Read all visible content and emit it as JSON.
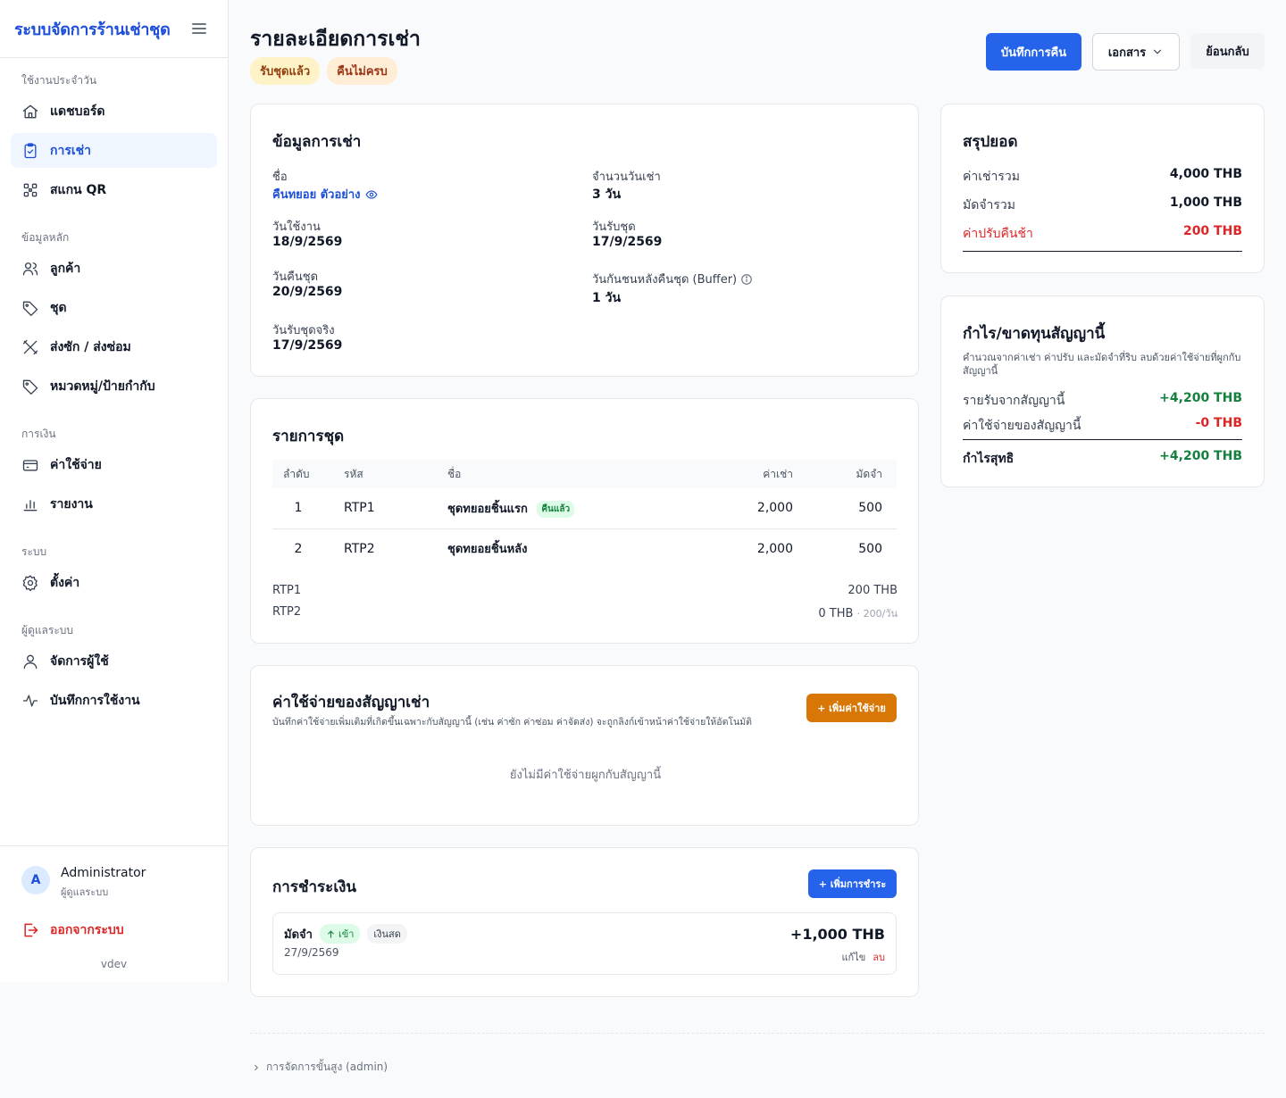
{
  "sidebar": {
    "title": "ระบบจัดการร้านเช่าชุด",
    "sections": {
      "daily": "ใช้งานประจำวัน",
      "master": "ข้อมูลหลัก",
      "finance": "การเงิน",
      "system": "ระบบ",
      "admin": "ผู้ดูแลระบบ"
    },
    "items": {
      "dashboard": "แดชบอร์ด",
      "rentals": "การเช่า",
      "scan_qr": "สแกน QR",
      "customers": "ลูกค้า",
      "outfits": "ชุด",
      "laundry": "ส่งซัก / ส่งซ่อม",
      "categories": "หมวดหมู่/ป้ายกำกับ",
      "expenses": "ค่าใช้จ่าย",
      "reports": "รายงาน",
      "settings": "ตั้งค่า",
      "users": "จัดการผู้ใช้",
      "activity_log": "บันทึกการใช้งาน"
    },
    "user": {
      "initial": "A",
      "name": "Administrator",
      "role": "ผู้ดูแลระบบ"
    },
    "logout": "ออกจากระบบ",
    "version": "vdev"
  },
  "header": {
    "title": "รายละเอียดการเช่า",
    "badges": [
      "รับชุดแล้ว",
      "คืนไม่ครบ"
    ],
    "actions": {
      "record_return": "บันทึกการคืน",
      "documents": "เอกสาร",
      "back": "ย้อนกลับ"
    }
  },
  "rental_info": {
    "title": "ข้อมูลการเช่า",
    "name_label": "ชื่อ",
    "name_value": "คืนทยอย ตัวอย่าง",
    "days_label": "จำนวนวันเช่า",
    "days_value": "3 วัน",
    "use_date_label": "วันใช้งาน",
    "use_date_value": "18/9/2569",
    "pickup_date_label": "วันรับชุด",
    "pickup_date_value": "17/9/2569",
    "return_date_label": "วันคืนชุด",
    "return_date_value": "20/9/2569",
    "buffer_label": "วันกันชนหลังคืนชุด (Buffer)",
    "buffer_value": "1 วัน",
    "actual_pickup_label": "วันรับชุดจริง",
    "actual_pickup_value": "17/9/2569"
  },
  "items": {
    "title": "รายการชุด",
    "columns": [
      "ลำดับ",
      "รหัส",
      "ชื่อ",
      "ค่าเช่า",
      "มัดจำ"
    ],
    "rows": [
      {
        "no": "1",
        "code": "RTP1",
        "name": "ชุดทยอยชิ้นแรก",
        "tag": "คืนแล้ว",
        "rent": "2,000",
        "deposit": "500"
      },
      {
        "no": "2",
        "code": "RTP2",
        "name": "ชุดทยอยชิ้นหลัง",
        "tag": "",
        "rent": "2,000",
        "deposit": "500"
      }
    ],
    "fines": [
      {
        "code": "RTP1",
        "amount": "200 THB",
        "note": ""
      },
      {
        "code": "RTP2",
        "amount": "0 THB",
        "note": "· 200/วัน"
      }
    ]
  },
  "expenses": {
    "title": "ค่าใช้จ่ายของสัญญาเช่า",
    "description": "บันทึกค่าใช้จ่ายเพิ่มเติมที่เกิดขึ้นเฉพาะกับสัญญานี้ (เช่น ค่าซัก ค่าซ่อม ค่าจัดส่ง) จะถูกลิงก์เข้าหน้าค่าใช้จ่ายให้อัตโนมัติ",
    "add_button": "+ เพิ่มค่าใช้จ่าย",
    "empty": "ยังไม่มีค่าใช้จ่ายผูกกับสัญญานี้"
  },
  "payments": {
    "title": "การชำระเงิน",
    "add_button": "+ เพิ่มการชำระ",
    "entries": [
      {
        "type": "มัดจำ",
        "direction": "เข้า",
        "method": "เงินสด",
        "date": "27/9/2569",
        "amount": "+1,000 THB",
        "edit": "แก้ไข",
        "delete": "ลบ"
      }
    ]
  },
  "summary": {
    "title": "สรุปยอด",
    "rows": [
      {
        "label": "ค่าเช่ารวม",
        "value": "4,000 THB"
      },
      {
        "label": "มัดจำรวม",
        "value": "1,000 THB"
      },
      {
        "label": "ค่าปรับคืนช้า",
        "value": "200 THB"
      }
    ]
  },
  "profit": {
    "title": "กำไร/ขาดทุนสัญญานี้",
    "description": "คำนวณจากค่าเช่า ค่าปรับ และมัดจำที่ริบ ลบด้วยค่าใช้จ่ายที่ผูกกับสัญญานี้",
    "income_label": "รายรับจากสัญญานี้",
    "income_value": "+4,200 THB",
    "expense_label": "ค่าใช้จ่ายของสัญญานี้",
    "expense_value": "-0 THB",
    "net_label": "กำไรสุทธิ",
    "net_value": "+4,200 THB"
  },
  "footer": {
    "advanced": "การจัดการขั้นสูง (admin)"
  },
  "colors": {
    "primary": "#2563eb",
    "danger": "#dc2626",
    "success": "#15803d",
    "warning_button": "#d97706"
  }
}
